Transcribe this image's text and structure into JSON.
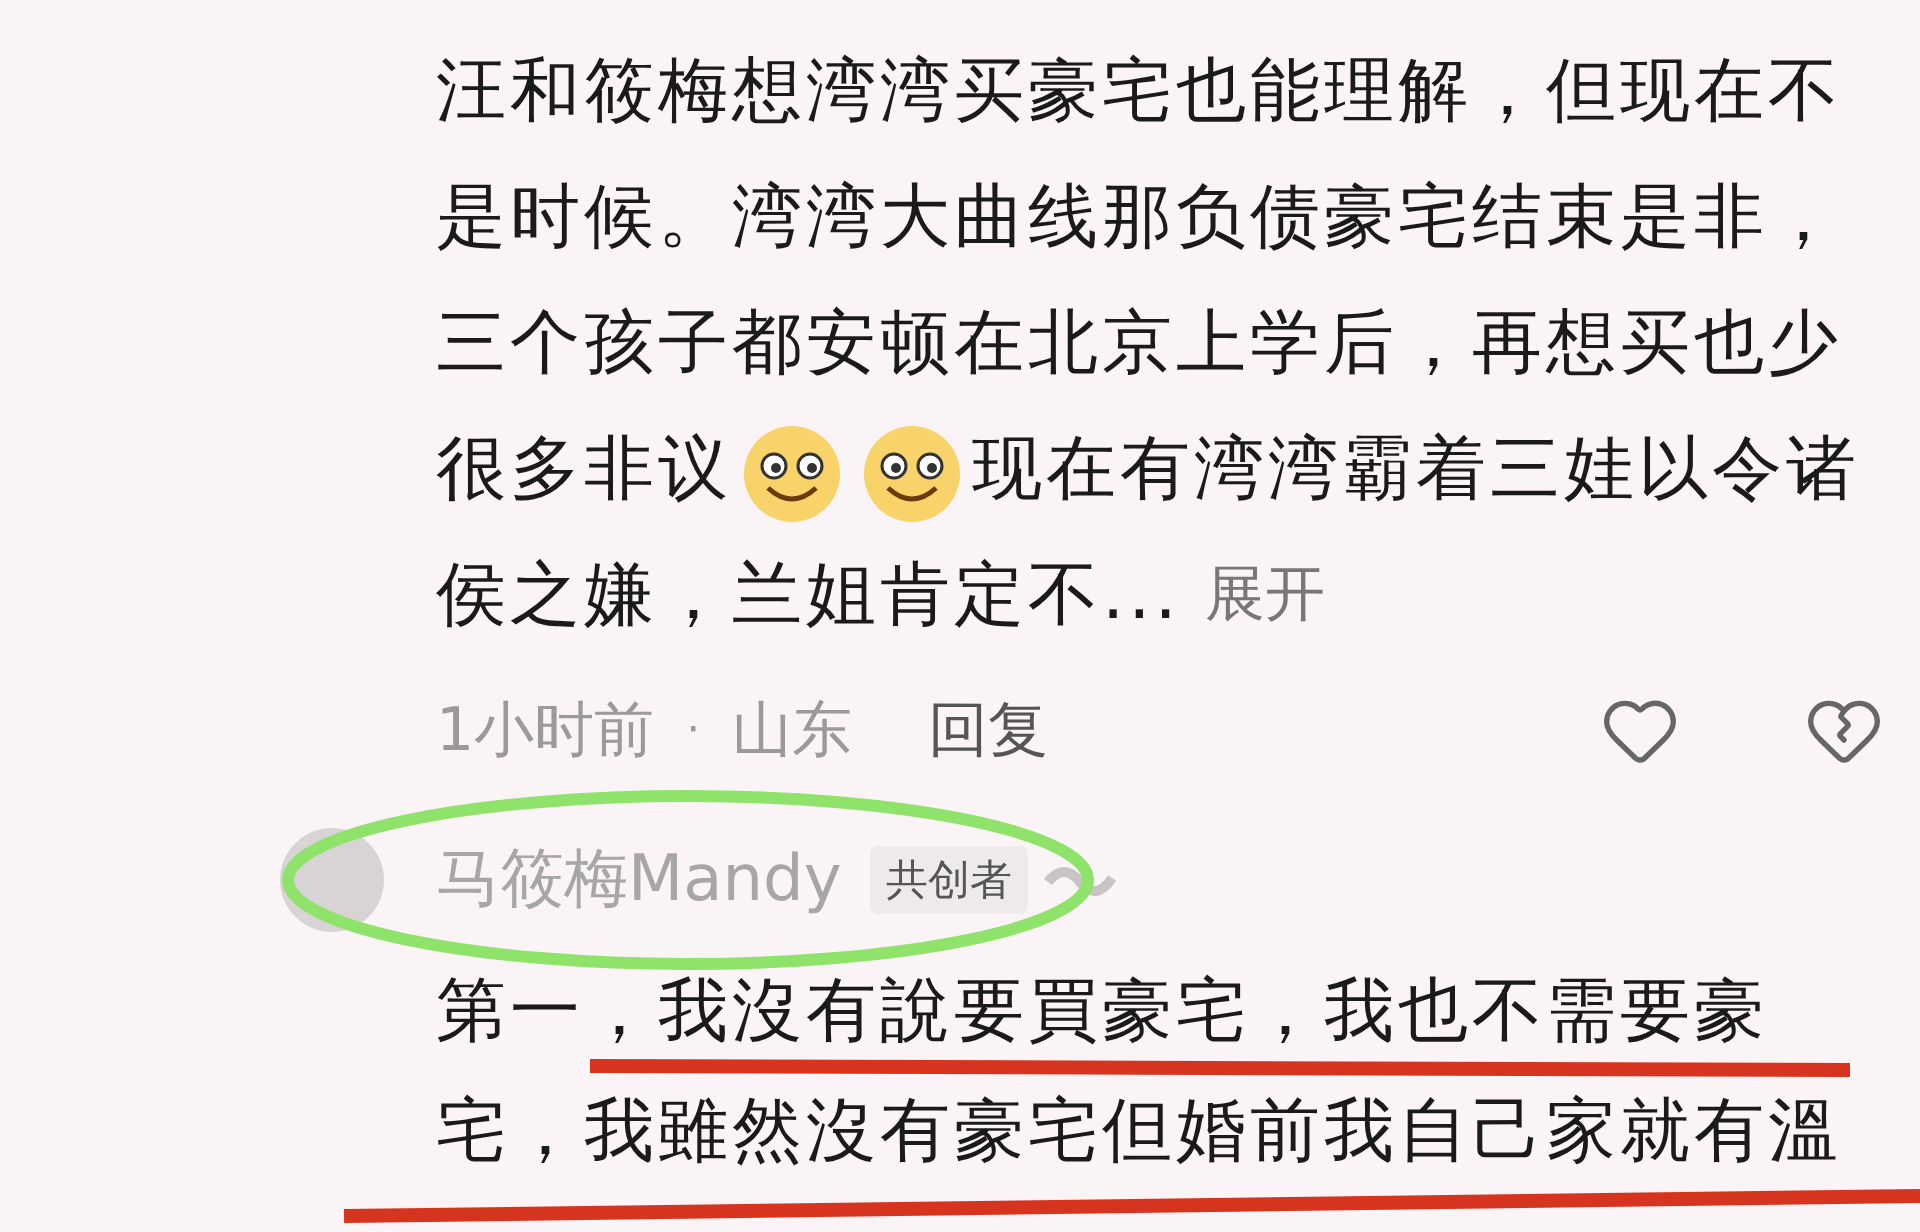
{
  "comment": {
    "lines": [
      {
        "segments": [
          {
            "kind": "text",
            "text": "汪和筱梅想湾湾买豪宅也能理解，但现在不"
          }
        ]
      },
      {
        "segments": [
          {
            "kind": "text",
            "text": "是时候。湾湾大曲线那负债豪宅结束是非，"
          }
        ]
      },
      {
        "segments": [
          {
            "kind": "text",
            "text": "三个孩子都安顿在北京上学后，再想买也少"
          }
        ]
      },
      {
        "segments": [
          {
            "kind": "text",
            "text": "很多非议"
          },
          {
            "kind": "emoji"
          },
          {
            "kind": "emoji"
          },
          {
            "kind": "text",
            "text": "现在有湾湾霸着三娃以令诸"
          }
        ]
      },
      {
        "segments": [
          {
            "kind": "text",
            "text": "侯之嫌，兰姐肯定不..."
          },
          {
            "kind": "link",
            "text": "展开"
          }
        ]
      }
    ],
    "meta": {
      "time": "1小时前",
      "separator": "·",
      "location": "山东",
      "reply": "回复"
    }
  },
  "reply": {
    "author": "马筱梅Mandy",
    "badge": "共创者",
    "lines": [
      "第一，我沒有說要買豪宅，我也不需要豪",
      "宅，我雖然沒有豪宅但婚前我自己家就有溫"
    ]
  }
}
